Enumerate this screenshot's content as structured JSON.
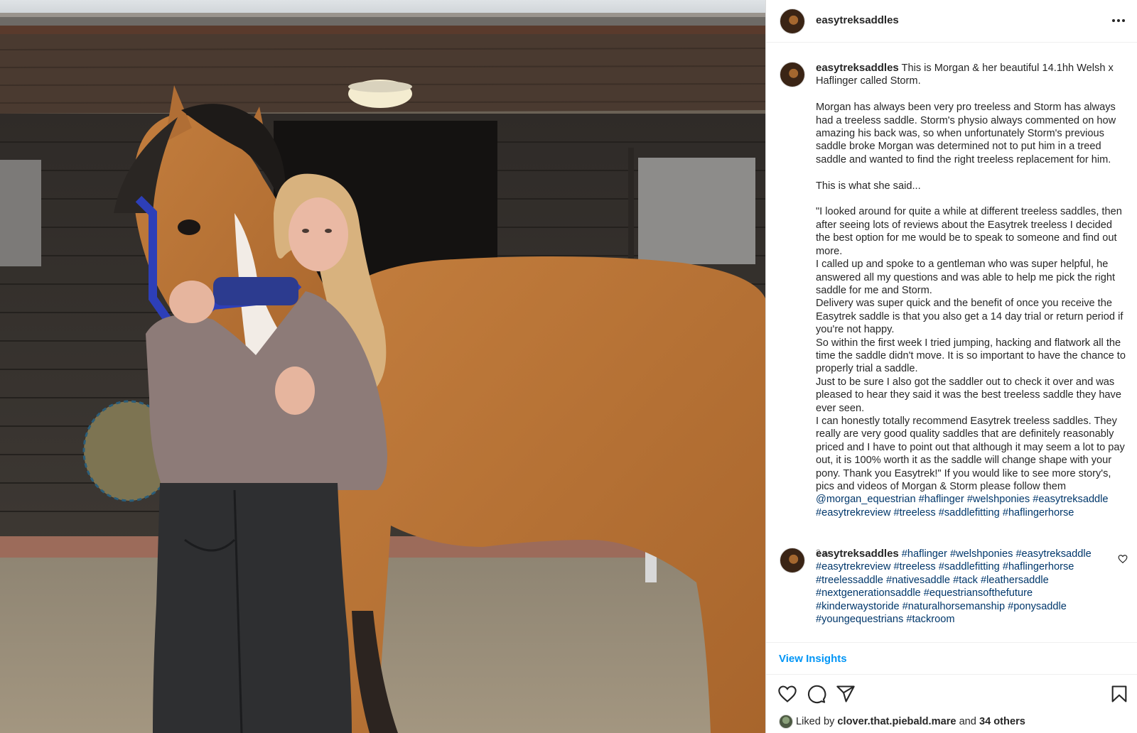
{
  "post": {
    "username": "easytreksaddles",
    "caption_intro": " This is Morgan & her beautiful 14.1hh Welsh x Haflinger called Storm.",
    "caption_body": "\n\nMorgan has always been very pro treeless and Storm has always had a treeless saddle. Storm's physio always commented on how amazing his back was, so when unfortunately Storm's previous saddle broke Morgan was determined not to put him in a treed saddle and wanted to find the right treeless replacement for him.\n\nThis is what she said...\n\n\"I looked around for quite a while at different treeless saddles, then after seeing lots of reviews about the Easytrek treeless I decided the best option for me would be to speak to someone and find out more.\nI called up and spoke to a gentleman who was super helpful, he answered all my questions and was able to help me pick the right saddle for me and Storm.\nDelivery was super quick and the benefit of once you receive the Easytrek saddle is that you also get a 14 day trial or return period if you're not happy.\nSo within the first week I tried jumping, hacking and flatwork all the time the saddle didn't move. It is so important to have the chance to properly trial a saddle.\nJust to be sure I also got the saddler out to check it over and was pleased to hear they said it was the best treeless saddle they have ever seen.\nI can honestly totally recommend Easytrek treeless saddles. They really are very good quality saddles that are definitely reasonably priced and I have to point out that although it may seem a lot to pay out, it is 100% worth it as the saddle will change shape with your pony. Thank you Easytrek!\" If you would like to see more story's, pics and videos of Morgan & Storm please follow them\n",
    "caption_tags": "@morgan_equestrian #haflinger #welshponies #easytreksaddle #easytrekreview #treeless #saddlefitting #haflingerhorse",
    "time": "2 w",
    "comment_username": "easytreksaddles",
    "comment_tags": " #haflinger #welshponies #easytreksaddle #easytrekreview #treeless #saddlefitting #haflingerhorse #treelessaddle #nativesaddle #tack #leathersaddle #nextgenerationsaddle #equestriansofthefuture #kinderwaystoride #naturalhorsemanship #ponysaddle #youngequestrians #tackroom",
    "insights_label": "View Insights",
    "liked_by_prefix": "Liked by ",
    "liked_by_user": "clover.that.piebald.mare",
    "liked_by_mid": " and ",
    "liked_by_others": "34 others"
  },
  "icons": {
    "more": "more-options-icon",
    "like": "heart-icon",
    "comment": "comment-icon",
    "share": "share-icon",
    "save": "bookmark-icon"
  },
  "colors": {
    "link": "#00376b",
    "insights": "#0095f6",
    "text": "#262626",
    "muted": "#8e8e8e"
  }
}
